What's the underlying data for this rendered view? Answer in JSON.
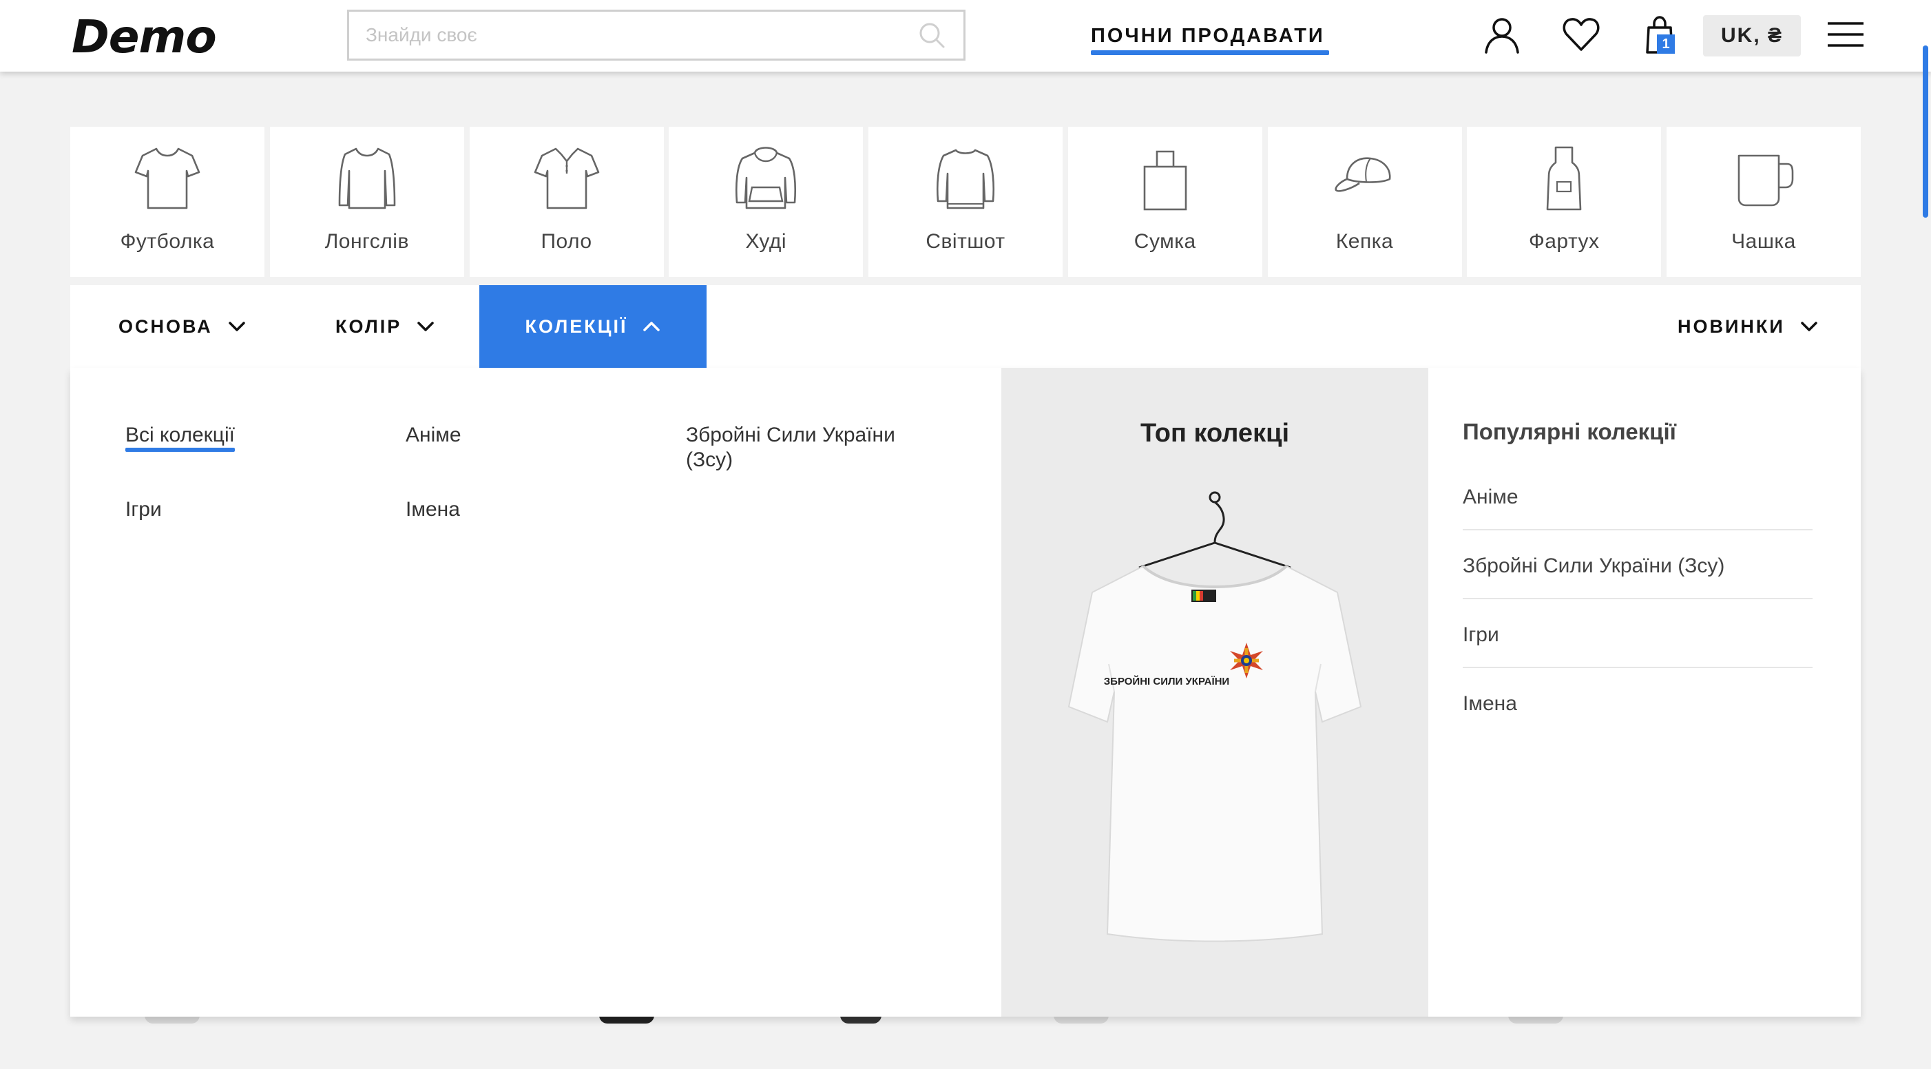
{
  "header": {
    "logo": "Demo",
    "search_placeholder": "Знайди своє",
    "sell_link": "ПОЧНИ ПРОДАВАТИ",
    "cart_count": "1",
    "lang_currency": "UK, ₴"
  },
  "categories": [
    {
      "label": "Футболка",
      "icon": "tshirt-icon"
    },
    {
      "label": "Лонгслів",
      "icon": "longsleeve-icon"
    },
    {
      "label": "Поло",
      "icon": "polo-icon"
    },
    {
      "label": "Худі",
      "icon": "hoodie-icon"
    },
    {
      "label": "Світшот",
      "icon": "sweatshirt-icon"
    },
    {
      "label": "Сумка",
      "icon": "bag-icon"
    },
    {
      "label": "Кепка",
      "icon": "cap-icon"
    },
    {
      "label": "Фартух",
      "icon": "apron-icon"
    },
    {
      "label": "Чашка",
      "icon": "mug-icon"
    }
  ],
  "filters": {
    "base": "ОСНОВА",
    "color": "КОЛІР",
    "collections": "КОЛЕКЦІЇ",
    "sort": "НОВИНКИ"
  },
  "collections_menu": {
    "links": [
      {
        "label": "Всі колекції"
      },
      {
        "label": "Аніме"
      },
      {
        "label": "Збройні Сили України (Зсу)"
      },
      {
        "label": "Ігри"
      },
      {
        "label": "Імена"
      }
    ],
    "top_title": "Топ колекці",
    "popular_title": "Популярні колекції",
    "popular_items": [
      {
        "label": "Аніме"
      },
      {
        "label": "Збройні Сили України (Зсу)"
      },
      {
        "label": "Ігри"
      },
      {
        "label": "Імена"
      }
    ],
    "shirt_print_text": "ЗБРОЙНІ СИЛИ УКРАЇНИ"
  },
  "colors": {
    "accent": "#2f7be5",
    "background": "#f2f2f2",
    "top_panel": "#ebebeb"
  }
}
